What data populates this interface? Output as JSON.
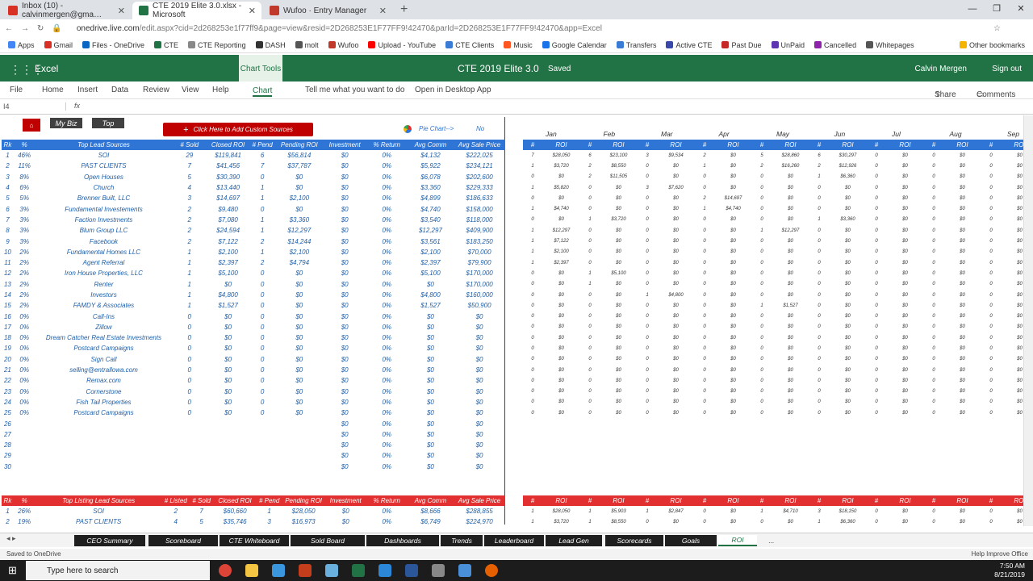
{
  "browser": {
    "tabs": [
      {
        "label": "Inbox (10) - calvinmergen@gma…",
        "color": "#d93025"
      },
      {
        "label": "CTE 2019 Elite 3.0.xlsx - Microsoft",
        "color": "#217346"
      },
      {
        "label": "Wufoo · Entry Manager",
        "color": "#c0392b"
      }
    ],
    "url_host": "onedrive.live.com",
    "url_rest": "/edit.aspx?cid=2d268253e1f77ff9&page=view&resid=2D268253E1F77FF9!42470&parId=2D268253E1F77FF9!42470&app=Excel",
    "bookmarks": [
      "Apps",
      "Gmail",
      "Files - OneDrive",
      "CTE",
      "CTE Reporting",
      "DASH",
      "molt",
      "Wufoo",
      "Upload - YouTube",
      "CTE Clients",
      "Music",
      "Google Calendar",
      "Transfers",
      "Active CTE",
      "Past Due",
      "UnPaid",
      "Cancelled",
      "Whitepages",
      "Other bookmarks"
    ]
  },
  "excel": {
    "app_name": "Excel",
    "chart_tools": "Chart Tools",
    "doc_title": "CTE 2019 Elite 3.0",
    "saved": "Saved",
    "user": "Calvin Mergen",
    "sign_out": "Sign out",
    "ribbon": [
      "File",
      "Home",
      "Insert",
      "Data",
      "Review",
      "View",
      "Help",
      "Chart",
      "Tell me what you want to do",
      "Open in Desktop App"
    ],
    "share": "Share",
    "comments": "Comments",
    "name_box": "I4",
    "fx": "fx"
  },
  "sheet": {
    "my_biz": "My Biz",
    "top": "Top",
    "custom_btn": "Click Here to Add Custom Sources",
    "pie_chart": "Pie Chart-->",
    "pie_value": "No",
    "lead_headers": [
      "Rk",
      "%",
      "Top Lead Sources",
      "# Sold",
      "Closed ROI",
      "# Pend",
      "Pending ROI",
      "Investment",
      "% Return",
      "Avg Comm",
      "Avg Sale Price"
    ],
    "lead_rows": [
      [
        "1",
        "46%",
        "SOI",
        "29",
        "$119,841",
        "6",
        "$56,814",
        "$0",
        "0%",
        "$4,132",
        "$222,025"
      ],
      [
        "2",
        "11%",
        "PAST CLIENTS",
        "7",
        "$41,456",
        "7",
        "$37,787",
        "$0",
        "0%",
        "$5,922",
        "$234,121"
      ],
      [
        "3",
        "8%",
        "Open Houses",
        "5",
        "$30,390",
        "0",
        "$0",
        "$0",
        "0%",
        "$6,078",
        "$202,600"
      ],
      [
        "4",
        "6%",
        "Church",
        "4",
        "$13,440",
        "1",
        "$0",
        "$0",
        "0%",
        "$3,360",
        "$229,333"
      ],
      [
        "5",
        "5%",
        "Brenner Built, LLC",
        "3",
        "$14,697",
        "1",
        "$2,100",
        "$0",
        "0%",
        "$4,899",
        "$186,633"
      ],
      [
        "6",
        "3%",
        "Fundamental Investements",
        "2",
        "$9,480",
        "0",
        "$0",
        "$0",
        "0%",
        "$4,740",
        "$158,000"
      ],
      [
        "7",
        "3%",
        "Faction Investments",
        "2",
        "$7,080",
        "1",
        "$3,360",
        "$0",
        "0%",
        "$3,540",
        "$118,000"
      ],
      [
        "8",
        "3%",
        "Blum Group LLC",
        "2",
        "$24,594",
        "1",
        "$12,297",
        "$0",
        "0%",
        "$12,297",
        "$409,900"
      ],
      [
        "9",
        "3%",
        "Facebook",
        "2",
        "$7,122",
        "2",
        "$14,244",
        "$0",
        "0%",
        "$3,561",
        "$183,250"
      ],
      [
        "10",
        "2%",
        "Fundamental Homes LLC",
        "1",
        "$2,100",
        "1",
        "$2,100",
        "$0",
        "0%",
        "$2,100",
        "$70,000"
      ],
      [
        "11",
        "2%",
        "Agent Referral",
        "1",
        "$2,397",
        "2",
        "$4,794",
        "$0",
        "0%",
        "$2,397",
        "$79,900"
      ],
      [
        "12",
        "2%",
        "Iron House Properties, LLC",
        "1",
        "$5,100",
        "0",
        "$0",
        "$0",
        "0%",
        "$5,100",
        "$170,000"
      ],
      [
        "13",
        "2%",
        "Renter",
        "1",
        "$0",
        "0",
        "$0",
        "$0",
        "0%",
        "$0",
        "$170,000"
      ],
      [
        "14",
        "2%",
        "Investors",
        "1",
        "$4,800",
        "0",
        "$0",
        "$0",
        "0%",
        "$4,800",
        "$160,000"
      ],
      [
        "15",
        "2%",
        "FAMDY & Associates",
        "1",
        "$1,527",
        "0",
        "$0",
        "$0",
        "0%",
        "$1,527",
        "$50,900"
      ],
      [
        "16",
        "0%",
        "Call-Ins",
        "0",
        "$0",
        "0",
        "$0",
        "$0",
        "0%",
        "$0",
        "$0"
      ],
      [
        "17",
        "0%",
        "Zillow",
        "0",
        "$0",
        "0",
        "$0",
        "$0",
        "0%",
        "$0",
        "$0"
      ],
      [
        "18",
        "0%",
        "Dream Catcher Real Estate Investments",
        "0",
        "$0",
        "0",
        "$0",
        "$0",
        "0%",
        "$0",
        "$0"
      ],
      [
        "19",
        "0%",
        "Postcard Campaigns",
        "0",
        "$0",
        "0",
        "$0",
        "$0",
        "0%",
        "$0",
        "$0"
      ],
      [
        "20",
        "0%",
        "Sign Call",
        "0",
        "$0",
        "0",
        "$0",
        "$0",
        "0%",
        "$0",
        "$0"
      ],
      [
        "21",
        "0%",
        "selling@entrallowa.com",
        "0",
        "$0",
        "0",
        "$0",
        "$0",
        "0%",
        "$0",
        "$0"
      ],
      [
        "22",
        "0%",
        "Remax.com",
        "0",
        "$0",
        "0",
        "$0",
        "$0",
        "0%",
        "$0",
        "$0"
      ],
      [
        "23",
        "0%",
        "Cornerstone",
        "0",
        "$0",
        "0",
        "$0",
        "$0",
        "0%",
        "$0",
        "$0"
      ],
      [
        "24",
        "0%",
        "Fish Tail Properties",
        "0",
        "$0",
        "0",
        "$0",
        "$0",
        "0%",
        "$0",
        "$0"
      ],
      [
        "25",
        "0%",
        "Postcard Campaigns",
        "0",
        "$0",
        "0",
        "$0",
        "$0",
        "0%",
        "$0",
        "$0"
      ],
      [
        "26",
        "",
        "",
        "",
        "",
        "",
        "",
        "$0",
        "0%",
        "$0",
        "$0"
      ],
      [
        "27",
        "",
        "",
        "",
        "",
        "",
        "",
        "$0",
        "0%",
        "$0",
        "$0"
      ],
      [
        "28",
        "",
        "",
        "",
        "",
        "",
        "",
        "$0",
        "0%",
        "$0",
        "$0"
      ],
      [
        "29",
        "",
        "",
        "",
        "",
        "",
        "",
        "$0",
        "0%",
        "$0",
        "$0"
      ],
      [
        "30",
        "",
        "",
        "",
        "",
        "",
        "",
        "$0",
        "0%",
        "$0",
        "$0"
      ]
    ],
    "listing_headers": [
      "Rk",
      "%",
      "Top Listing Lead Sources",
      "# Listed",
      "# Sold",
      "Closed ROI",
      "# Pend",
      "Pending ROI",
      "Investment",
      "% Return",
      "Avg Comm",
      "Avg Sale Price"
    ],
    "listing_rows": [
      [
        "1",
        "26%",
        "SOI",
        "2",
        "7",
        "$60,660",
        "1",
        "$28,050",
        "$0",
        "0%",
        "$8,666",
        "$288,855"
      ],
      [
        "2",
        "19%",
        "PAST CLIENTS",
        "4",
        "5",
        "$35,746",
        "3",
        "$16,973",
        "$0",
        "0%",
        "$6,749",
        "$224,970"
      ]
    ],
    "months": [
      "Jan",
      "Feb",
      "Mar",
      "Apr",
      "May",
      "Jun",
      "Jul",
      "Aug",
      "Sep"
    ],
    "month_cols": [
      "#",
      "ROI"
    ],
    "monthly_rows": [
      [
        "7",
        "$28,050",
        "6",
        "$23,100",
        "3",
        "$9,534",
        "2",
        "$0",
        "5",
        "$28,860",
        "6",
        "$30,297",
        "0",
        "$0",
        "0",
        "$0",
        "0",
        "$0"
      ],
      [
        "1",
        "$3,720",
        "2",
        "$8,550",
        "0",
        "$0",
        "1",
        "$0",
        "2",
        "$16,260",
        "2",
        "$12,926",
        "0",
        "$0",
        "0",
        "$0",
        "0",
        "$0"
      ],
      [
        "0",
        "$0",
        "2",
        "$11,505",
        "0",
        "$0",
        "0",
        "$0",
        "0",
        "$0",
        "1",
        "$6,360",
        "0",
        "$0",
        "0",
        "$0",
        "0",
        "$0"
      ],
      [
        "1",
        "$5,820",
        "0",
        "$0",
        "3",
        "$7,620",
        "0",
        "$0",
        "0",
        "$0",
        "0",
        "$0",
        "0",
        "$0",
        "0",
        "$0",
        "0",
        "$0"
      ],
      [
        "0",
        "$0",
        "0",
        "$0",
        "0",
        "$0",
        "2",
        "$14,697",
        "0",
        "$0",
        "0",
        "$0",
        "0",
        "$0",
        "0",
        "$0",
        "0",
        "$0"
      ],
      [
        "1",
        "$4,740",
        "0",
        "$0",
        "0",
        "$0",
        "1",
        "$4,740",
        "0",
        "$0",
        "0",
        "$0",
        "0",
        "$0",
        "0",
        "$0",
        "0",
        "$0"
      ],
      [
        "0",
        "$0",
        "1",
        "$3,720",
        "0",
        "$0",
        "0",
        "$0",
        "0",
        "$0",
        "1",
        "$3,360",
        "0",
        "$0",
        "0",
        "$0",
        "0",
        "$0"
      ],
      [
        "1",
        "$12,297",
        "0",
        "$0",
        "0",
        "$0",
        "0",
        "$0",
        "1",
        "$12,297",
        "0",
        "$0",
        "0",
        "$0",
        "0",
        "$0",
        "0",
        "$0"
      ],
      [
        "1",
        "$7,122",
        "0",
        "$0",
        "0",
        "$0",
        "0",
        "$0",
        "0",
        "$0",
        "0",
        "$0",
        "0",
        "$0",
        "0",
        "$0",
        "0",
        "$0"
      ],
      [
        "1",
        "$2,100",
        "0",
        "$0",
        "0",
        "$0",
        "0",
        "$0",
        "0",
        "$0",
        "0",
        "$0",
        "0",
        "$0",
        "0",
        "$0",
        "0",
        "$0"
      ],
      [
        "1",
        "$2,397",
        "0",
        "$0",
        "0",
        "$0",
        "0",
        "$0",
        "0",
        "$0",
        "0",
        "$0",
        "0",
        "$0",
        "0",
        "$0",
        "0",
        "$0"
      ],
      [
        "0",
        "$0",
        "1",
        "$5,100",
        "0",
        "$0",
        "0",
        "$0",
        "0",
        "$0",
        "0",
        "$0",
        "0",
        "$0",
        "0",
        "$0",
        "0",
        "$0"
      ],
      [
        "0",
        "$0",
        "1",
        "$0",
        "0",
        "$0",
        "0",
        "$0",
        "0",
        "$0",
        "0",
        "$0",
        "0",
        "$0",
        "0",
        "$0",
        "0",
        "$0"
      ],
      [
        "0",
        "$0",
        "0",
        "$0",
        "1",
        "$4,800",
        "0",
        "$0",
        "0",
        "$0",
        "0",
        "$0",
        "0",
        "$0",
        "0",
        "$0",
        "0",
        "$0"
      ],
      [
        "0",
        "$0",
        "0",
        "$0",
        "0",
        "$0",
        "0",
        "$0",
        "1",
        "$1,527",
        "0",
        "$0",
        "0",
        "$0",
        "0",
        "$0",
        "0",
        "$0"
      ],
      [
        "0",
        "$0",
        "0",
        "$0",
        "0",
        "$0",
        "0",
        "$0",
        "0",
        "$0",
        "0",
        "$0",
        "0",
        "$0",
        "0",
        "$0",
        "0",
        "$0"
      ],
      [
        "0",
        "$0",
        "0",
        "$0",
        "0",
        "$0",
        "0",
        "$0",
        "0",
        "$0",
        "0",
        "$0",
        "0",
        "$0",
        "0",
        "$0",
        "0",
        "$0"
      ],
      [
        "0",
        "$0",
        "0",
        "$0",
        "0",
        "$0",
        "0",
        "$0",
        "0",
        "$0",
        "0",
        "$0",
        "0",
        "$0",
        "0",
        "$0",
        "0",
        "$0"
      ],
      [
        "0",
        "$0",
        "0",
        "$0",
        "0",
        "$0",
        "0",
        "$0",
        "0",
        "$0",
        "0",
        "$0",
        "0",
        "$0",
        "0",
        "$0",
        "0",
        "$0"
      ],
      [
        "0",
        "$0",
        "0",
        "$0",
        "0",
        "$0",
        "0",
        "$0",
        "0",
        "$0",
        "0",
        "$0",
        "0",
        "$0",
        "0",
        "$0",
        "0",
        "$0"
      ],
      [
        "0",
        "$0",
        "0",
        "$0",
        "0",
        "$0",
        "0",
        "$0",
        "0",
        "$0",
        "0",
        "$0",
        "0",
        "$0",
        "0",
        "$0",
        "0",
        "$0"
      ],
      [
        "0",
        "$0",
        "0",
        "$0",
        "0",
        "$0",
        "0",
        "$0",
        "0",
        "$0",
        "0",
        "$0",
        "0",
        "$0",
        "0",
        "$0",
        "0",
        "$0"
      ],
      [
        "0",
        "$0",
        "0",
        "$0",
        "0",
        "$0",
        "0",
        "$0",
        "0",
        "$0",
        "0",
        "$0",
        "0",
        "$0",
        "0",
        "$0",
        "0",
        "$0"
      ],
      [
        "0",
        "$0",
        "0",
        "$0",
        "0",
        "$0",
        "0",
        "$0",
        "0",
        "$0",
        "0",
        "$0",
        "0",
        "$0",
        "0",
        "$0",
        "0",
        "$0"
      ],
      [
        "0",
        "$0",
        "0",
        "$0",
        "0",
        "$0",
        "0",
        "$0",
        "0",
        "$0",
        "0",
        "$0",
        "0",
        "$0",
        "0",
        "$0",
        "0",
        "$0"
      ]
    ],
    "monthly_listing_rows": [
      [
        "1",
        "$28,050",
        "1",
        "$5,903",
        "1",
        "$2,847",
        "0",
        "$0",
        "1",
        "$4,710",
        "3",
        "$18,150",
        "0",
        "$0",
        "0",
        "$0",
        "0",
        "$0"
      ],
      [
        "1",
        "$3,720",
        "1",
        "$8,550",
        "0",
        "$0",
        "0",
        "$0",
        "0",
        "$0",
        "1",
        "$6,360",
        "0",
        "$0",
        "0",
        "$0",
        "0",
        "$0"
      ]
    ]
  },
  "sheet_tabs": [
    "CEO Summary",
    "Scoreboard",
    "CTE Whiteboard",
    "Sold Board",
    "Dashboards",
    "Trends",
    "Leaderboard",
    "Lead Gen",
    "Scorecards",
    "Goals",
    "ROI",
    "..."
  ],
  "status": {
    "left": "Saved to OneDrive",
    "right": "Help Improve Office"
  },
  "taskbar": {
    "search": "Type here to search",
    "time": "7:50 AM",
    "date": "8/21/2019"
  }
}
